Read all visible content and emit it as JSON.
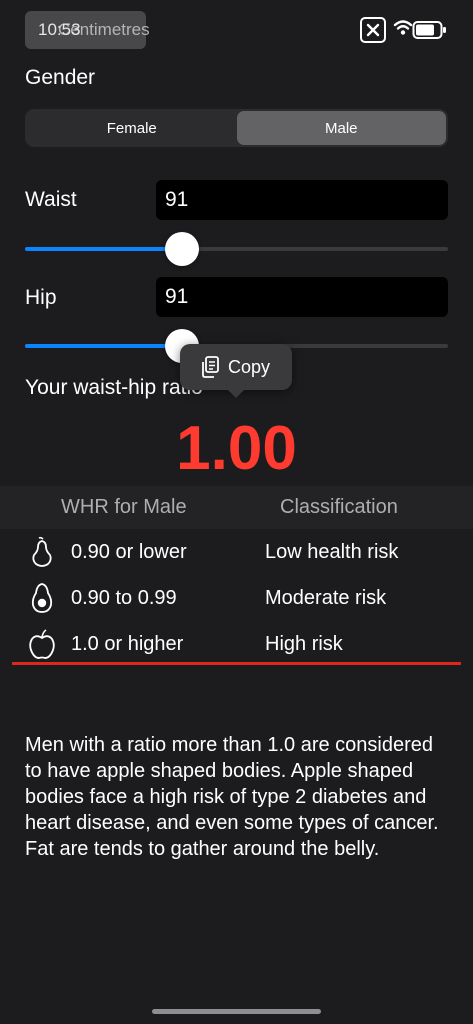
{
  "status_bar": {
    "time": "10:53",
    "unit_button": "Centimetres",
    "close_icon": "close-x-icon",
    "wifi_icon": "wifi-icon",
    "battery_icon": "battery-icon"
  },
  "form": {
    "gender_label": "Gender",
    "gender_options": [
      "Female",
      "Male"
    ],
    "gender_selected": "Male",
    "waist_label": "Waist",
    "waist_value": "91",
    "waist_slider_fraction": 0.37,
    "hip_label": "Hip",
    "hip_value": "91",
    "hip_slider_fraction": 0.37
  },
  "context_menu": {
    "copy_label": "Copy",
    "copy_icon": "copy-icon"
  },
  "result": {
    "label": "Your waist-hip ratio",
    "value": "1.00",
    "value_color": "#ff3b30"
  },
  "table": {
    "headers": [
      "WHR for Male",
      "Classification"
    ],
    "rows": [
      {
        "icon": "pear-icon",
        "range": "0.90 or lower",
        "classification": "Low health risk"
      },
      {
        "icon": "avocado-icon",
        "range": "0.90 to 0.99",
        "classification": "Moderate risk"
      },
      {
        "icon": "apple-icon",
        "range": "1.0 or higher",
        "classification": "High risk"
      }
    ],
    "highlight_color": "#e0261b"
  },
  "description": "Men with a ratio more than 1.0 are considered to have apple shaped bodies. Apple shaped bodies face a high risk of type 2 diabetes and heart disease, and even some types of cancer. Fat are tends to gather around the belly.",
  "colors": {
    "accent": "#0a84ff",
    "background": "#1c1c1e"
  }
}
